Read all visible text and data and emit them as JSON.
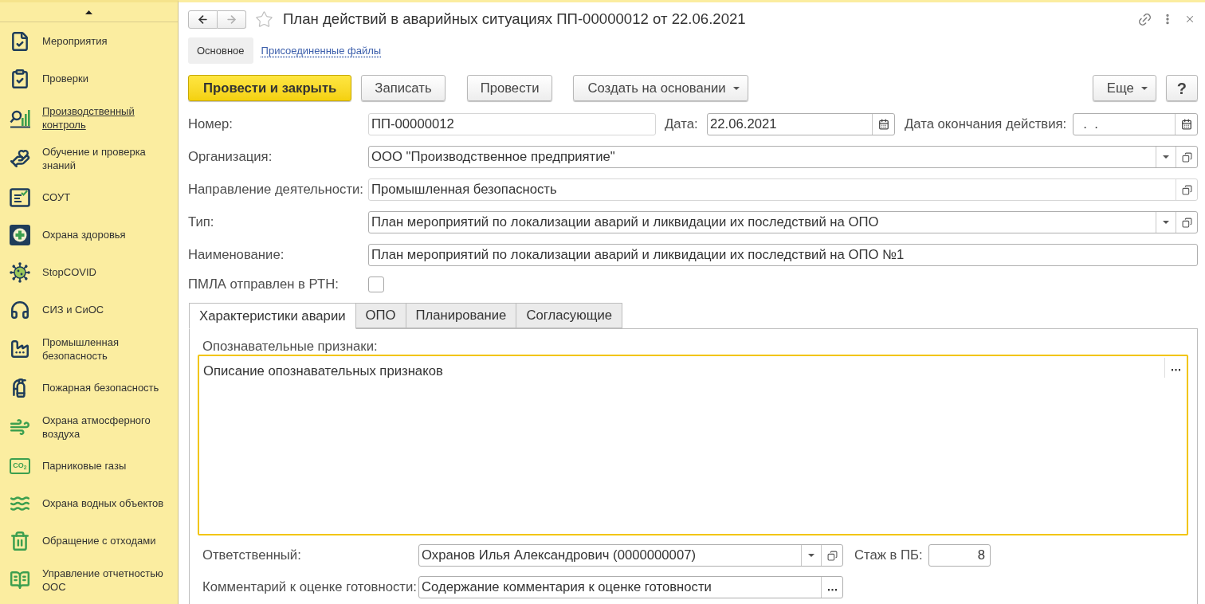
{
  "window": {
    "title": "План действий в аварийных ситуациях ПП-00000012 от 22.06.2021",
    "favorite": false,
    "back_enabled": true,
    "forward_enabled": false
  },
  "sidebar": {
    "items": [
      {
        "label": "Мероприятия",
        "selected": false
      },
      {
        "label": "Проверки",
        "selected": false
      },
      {
        "label": "Производственный контроль",
        "selected": true
      },
      {
        "label": "Обучение и проверка знаний",
        "selected": false
      },
      {
        "label": "СОУТ",
        "selected": false
      },
      {
        "label": "Охрана здоровья",
        "selected": false
      },
      {
        "label": "StopCOVID",
        "selected": false
      },
      {
        "label": "СИЗ и СиОС",
        "selected": false
      },
      {
        "label": "Промышленная безопасность",
        "selected": false
      },
      {
        "label": "Пожарная безопасность",
        "selected": false
      },
      {
        "label": "Охрана атмосферного воздуха",
        "selected": false
      },
      {
        "label": "Парниковые газы",
        "selected": false,
        "icon_text": "CO$_{2}$"
      },
      {
        "label": "Охрана водных объектов",
        "selected": false
      },
      {
        "label": "Обращение с отходами",
        "selected": false
      },
      {
        "label": "Управление отчетностью ООС",
        "selected": false
      }
    ]
  },
  "form_tabs": [
    {
      "label": "Основное",
      "selected": true
    },
    {
      "label": "Присоединенные файлы",
      "selected": false
    }
  ],
  "toolbar": {
    "buttons": [
      {
        "label": "Провести и закрыть",
        "kind": "primary"
      },
      {
        "label": "Записать",
        "kind": "plain"
      },
      {
        "label": "Провести",
        "kind": "plain"
      },
      {
        "label": "Создать на основании",
        "kind": "menu"
      }
    ],
    "right_buttons": [
      {
        "label": "Еще",
        "kind": "menu"
      },
      {
        "label": "?",
        "kind": "help"
      }
    ]
  },
  "header_fields": {
    "number": {
      "label": "Номер:",
      "value": "ПП-00000012"
    },
    "date": {
      "label": "Дата:",
      "value": "22.06.2021"
    },
    "end_date": {
      "label": "Дата окончания действия:",
      "value": "  .  ."
    }
  },
  "rows": [
    {
      "label": "Организация:",
      "value": "ООО \"Производственное предприятие\"",
      "kind": "select"
    },
    {
      "label": "Направление деятельности:",
      "value": "Промышленная безопасность",
      "kind": "readonly"
    },
    {
      "label": "Тип:",
      "value": "План мероприятий по локализации аварий и ликвидации их последствий на ОПО",
      "kind": "select"
    },
    {
      "label": "Наименование:",
      "value": "План мероприятий по локализации аварий и ликвидации их последствий на ОПО №1",
      "kind": "text"
    }
  ],
  "sent_checkbox": {
    "label": "ПМЛА отправлен в РТН:",
    "checked": false
  },
  "tabs": [
    {
      "label": "Характеристики аварии",
      "selected": true
    },
    {
      "label": "ОПО",
      "selected": false
    },
    {
      "label": "Планирование",
      "selected": false
    },
    {
      "label": "Согласующие",
      "selected": false
    }
  ],
  "tab_panel": {
    "signs": {
      "label": "Опознавательные признаки:",
      "value": "Описание опознавательных признаков",
      "focused": true
    },
    "responsible": {
      "label": "Ответственный:",
      "value": "Охранов Илья Александрович (0000000007)"
    },
    "experience": {
      "label": "Стаж в ПБ:",
      "value": "8"
    },
    "comment": {
      "label": "Комментарий к оценке готовности:",
      "value": "Содержание комментария к оценке готовности"
    }
  }
}
